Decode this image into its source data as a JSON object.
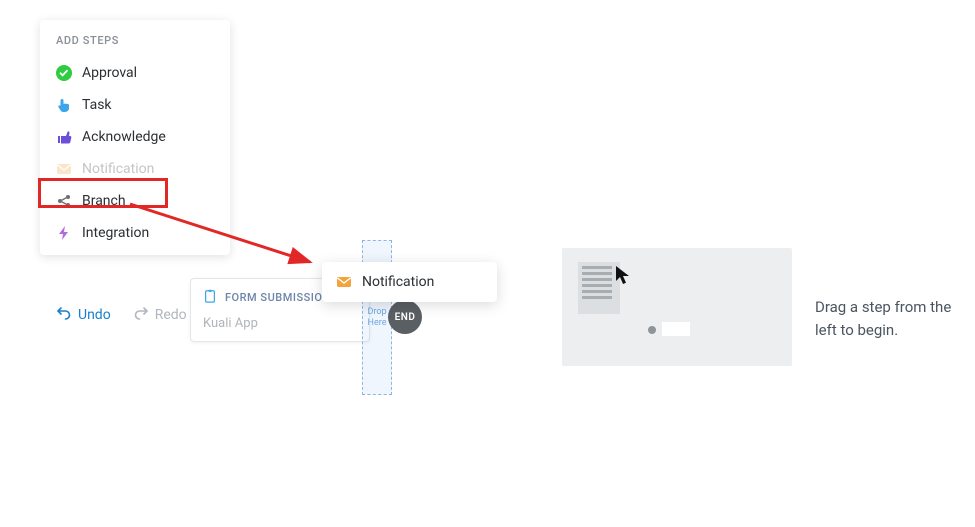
{
  "steps_panel": {
    "header": "ADD STEPS",
    "items": [
      {
        "label": "Approval",
        "icon": "check-circle-icon"
      },
      {
        "label": "Task",
        "icon": "pointer-icon"
      },
      {
        "label": "Acknowledge",
        "icon": "thumbs-up-icon"
      },
      {
        "label": "Notification",
        "icon": "mail-icon"
      },
      {
        "label": "Branch",
        "icon": "share-icon"
      },
      {
        "label": "Integration",
        "icon": "bolt-icon"
      }
    ],
    "highlighted_index": 3
  },
  "undo_label": "Undo",
  "redo_label": "Redo",
  "form_card": {
    "header": "FORM SUBMISSION",
    "body": "Kuali App"
  },
  "drop_zone": {
    "line1": "Drop",
    "line2": "Here"
  },
  "end_badge": "END",
  "drag_chip": {
    "label": "Notification"
  },
  "help_text": "Drag a step from the left to begin."
}
